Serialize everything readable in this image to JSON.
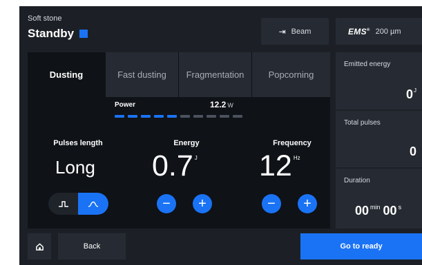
{
  "header": {
    "mode_subtitle": "Soft stone",
    "mode_title": "Standby",
    "status_color": "#1a73f5",
    "beam_label": "Beam",
    "beam_icon": "arrow-right-to-bar-icon",
    "ems_logo": "EMS",
    "ems_logo_mark": "®",
    "fiber_size": "200 µm"
  },
  "tabs": [
    {
      "label": "Dusting",
      "active": true
    },
    {
      "label": "Fast dusting",
      "active": false
    },
    {
      "label": "Fragmentation",
      "active": false
    },
    {
      "label": "Popcorning",
      "active": false
    }
  ],
  "power": {
    "label": "Power",
    "value": "12.2",
    "unit": "W",
    "segments_total": 10,
    "segments_active": 5
  },
  "pulses_length": {
    "label": "Pulses length",
    "value": "Long",
    "options": [
      "short-pulse-icon",
      "long-pulse-icon"
    ],
    "selected_index": 1
  },
  "energy": {
    "label": "Energy",
    "value": "0.7",
    "unit": "J",
    "minus": "−",
    "plus": "+"
  },
  "frequency": {
    "label": "Frequency",
    "value": "12",
    "unit": "Hz",
    "minus": "−",
    "plus": "+"
  },
  "stats": {
    "emitted_energy": {
      "label": "Emitted energy",
      "value": "0",
      "unit": "J"
    },
    "total_pulses": {
      "label": "Total pulses",
      "value": "0"
    },
    "duration": {
      "label": "Duration",
      "minutes": "00",
      "minutes_unit": "min",
      "seconds": "00",
      "seconds_unit": "s"
    }
  },
  "footer": {
    "home_icon": "home-icon",
    "back_label": "Back",
    "ready_label": "Go to ready"
  },
  "colors": {
    "accent": "#1a73f5",
    "background": "#1c2026",
    "panel": "#0f1217",
    "tile": "#262b33"
  }
}
